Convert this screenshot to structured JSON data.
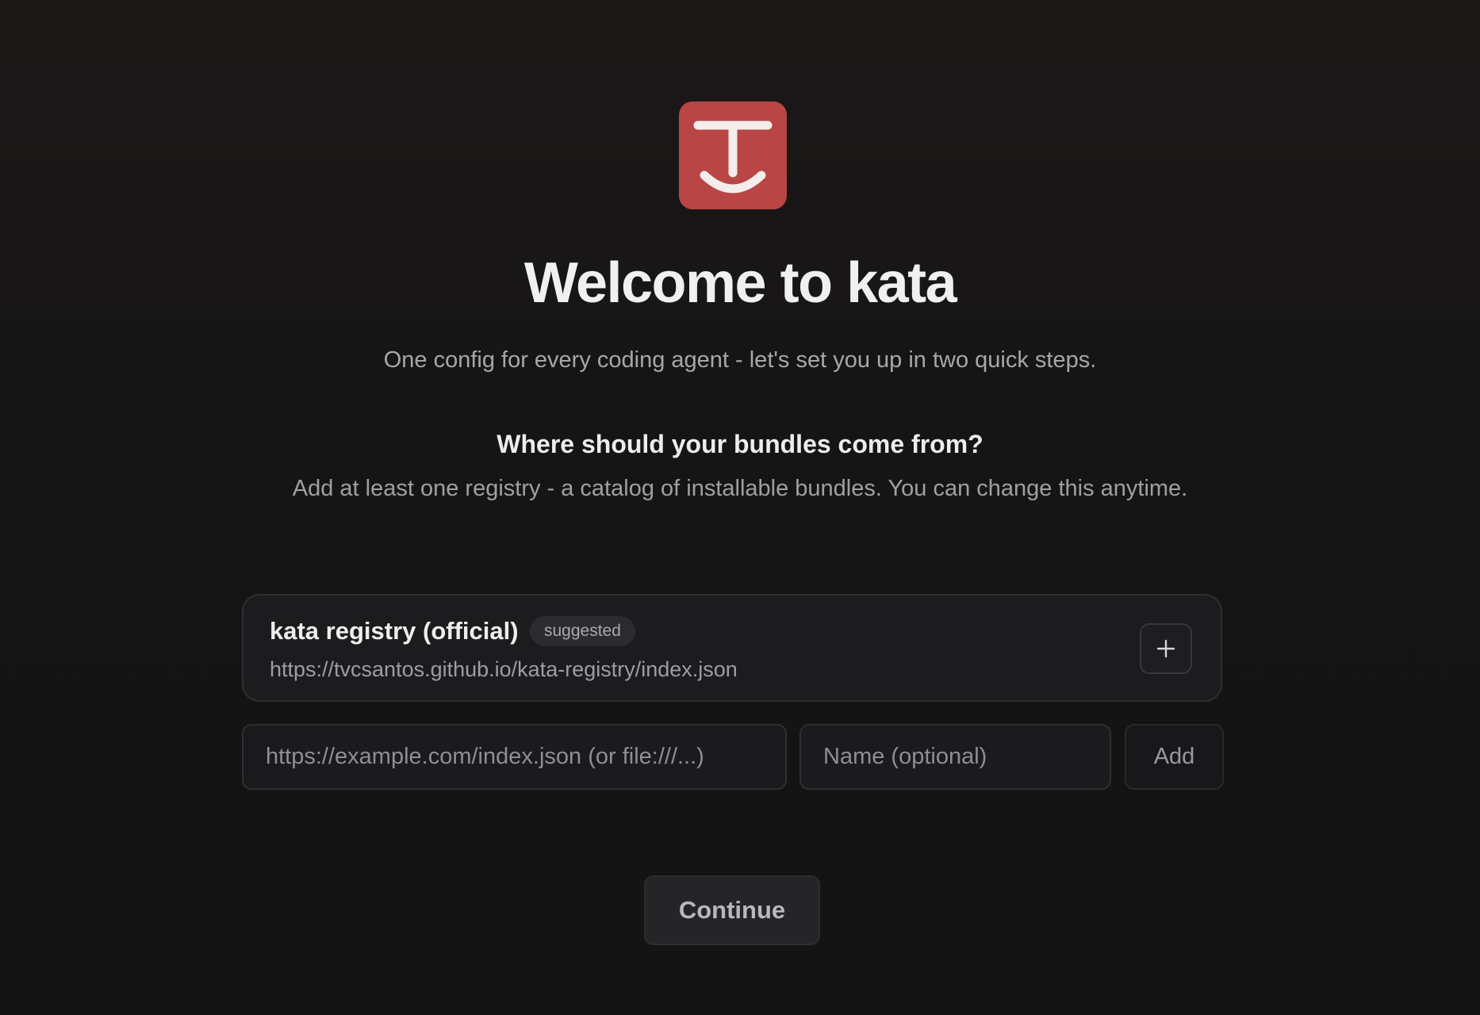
{
  "logo": {
    "icon": "kata-smile-logo-icon",
    "color": "#b94545"
  },
  "welcome": {
    "title": "Welcome to kata",
    "subtitle": "One config for every coding agent - let's set you up in two quick steps."
  },
  "step": {
    "question": "Where should your bundles come from?",
    "hint": "Add at least one registry - a catalog of installable bundles. You can change this anytime."
  },
  "suggested_registry": {
    "name": "kata registry (official)",
    "badge": "suggested",
    "url": "https://tvcsantos.github.io/kata-registry/index.json",
    "add_icon": "plus-icon"
  },
  "add_form": {
    "url_placeholder": "https://example.com/index.json (or file:///...)",
    "name_placeholder": "Name (optional)",
    "add_label": "Add"
  },
  "footer": {
    "continue_label": "Continue"
  }
}
